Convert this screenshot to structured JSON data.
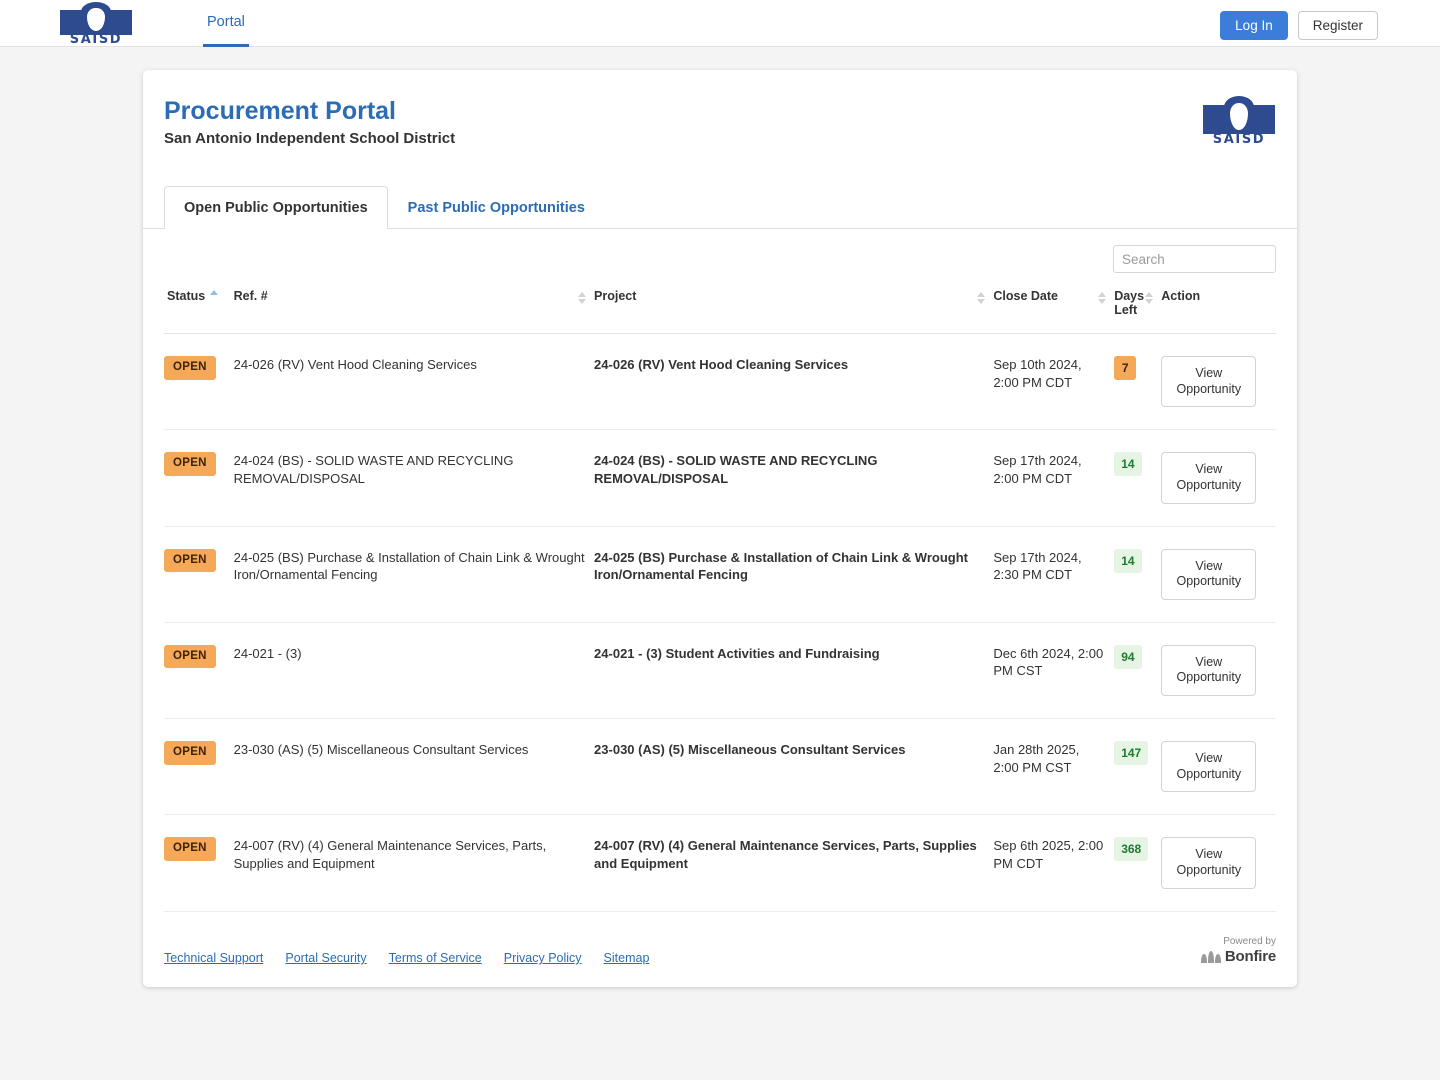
{
  "topnav": {
    "logo_text": "SAISD",
    "nav_item": "Portal",
    "login_label": "Log In",
    "register_label": "Register"
  },
  "header": {
    "title": "Procurement Portal",
    "subtitle": "San Antonio Independent School District",
    "logo_text": "SAISD"
  },
  "tabs": [
    {
      "label": "Open Public Opportunities",
      "active": true
    },
    {
      "label": "Past Public Opportunities",
      "active": false
    }
  ],
  "search": {
    "placeholder": "Search",
    "value": ""
  },
  "table": {
    "columns": [
      {
        "label": "Status",
        "sort": "asc"
      },
      {
        "label": "Ref. #",
        "sort": "none"
      },
      {
        "label": "Project",
        "sort": "none"
      },
      {
        "label": "Close Date",
        "sort": "none"
      },
      {
        "label": "Days Left",
        "sort": "none"
      },
      {
        "label": "Action",
        "sort": null
      }
    ],
    "rows": [
      {
        "status": "OPEN",
        "ref": "24-026 (RV) Vent Hood Cleaning Services",
        "project": "24-026 (RV) Vent Hood Cleaning Services",
        "close_date": "Sep 10th 2024, 2:00 PM CDT",
        "days_left": "7",
        "days_state": "urgent",
        "action": "View Opportunity"
      },
      {
        "status": "OPEN",
        "ref": "24-024 (BS) - SOLID WASTE AND RECYCLING REMOVAL/DISPOSAL",
        "project": "24-024 (BS) - SOLID WASTE AND RECYCLING REMOVAL/DISPOSAL",
        "close_date": "Sep 17th 2024, 2:00 PM CDT",
        "days_left": "14",
        "days_state": "ok",
        "action": "View Opportunity"
      },
      {
        "status": "OPEN",
        "ref": "24-025 (BS) Purchase & Installation of Chain Link & Wrought Iron/Ornamental Fencing",
        "project": "24-025 (BS) Purchase & Installation of Chain Link & Wrought Iron/Ornamental Fencing",
        "close_date": "Sep 17th 2024, 2:30 PM CDT",
        "days_left": "14",
        "days_state": "ok",
        "action": "View Opportunity"
      },
      {
        "status": "OPEN",
        "ref": "24-021 - (3)",
        "project": "24-021 - (3) Student Activities and Fundraising",
        "close_date": "Dec 6th 2024, 2:00 PM CST",
        "days_left": "94",
        "days_state": "ok",
        "action": "View Opportunity"
      },
      {
        "status": "OPEN",
        "ref": "23-030 (AS) (5) Miscellaneous Consultant Services",
        "project": "23-030 (AS) (5) Miscellaneous Consultant Services",
        "close_date": "Jan 28th 2025, 2:00 PM CST",
        "days_left": "147",
        "days_state": "ok",
        "action": "View Opportunity"
      },
      {
        "status": "OPEN",
        "ref": "24-007 (RV) (4) General Maintenance Services, Parts, Supplies and Equipment",
        "project": "24-007 (RV) (4) General Maintenance Services, Parts, Supplies and Equipment",
        "close_date": "Sep 6th 2025, 2:00 PM CDT",
        "days_left": "368",
        "days_state": "ok",
        "action": "View Opportunity"
      }
    ]
  },
  "footer": {
    "links": [
      "Technical Support",
      "Portal Security",
      "Terms of Service",
      "Privacy Policy",
      "Sitemap"
    ],
    "powered_by_label": "Powered by",
    "powered_by_brand": "Bonfire"
  },
  "colors": {
    "accent_blue": "#2b6cb5",
    "logo_blue": "#2d4b8e",
    "badge_orange": "#f3a957",
    "badge_green_bg": "#e5f4e3",
    "badge_green_text": "#1f7a33"
  }
}
